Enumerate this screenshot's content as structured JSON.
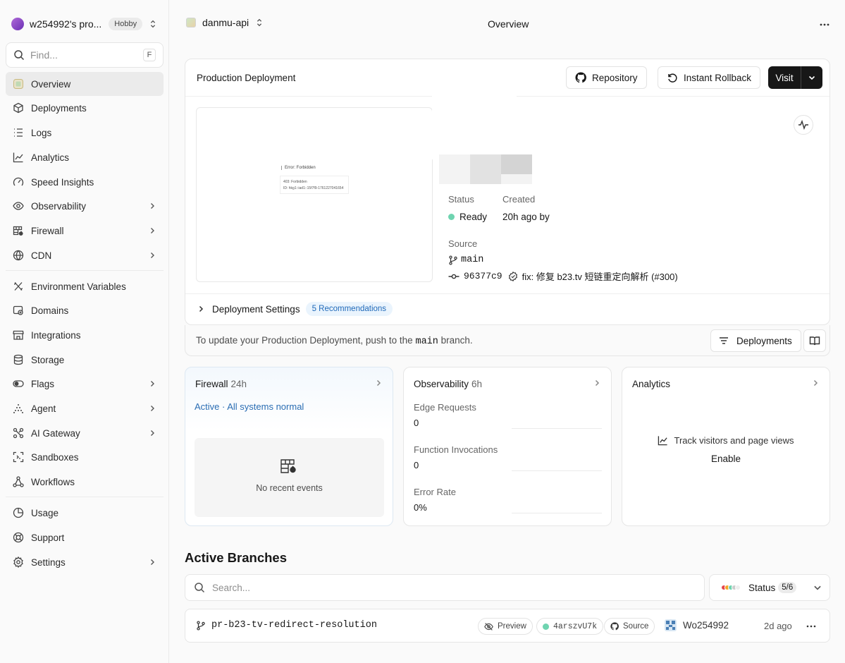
{
  "sidebar": {
    "team_name": "w254992's pro...",
    "plan_badge": "Hobby",
    "find_placeholder": "Find...",
    "find_shortcut": "F",
    "items": [
      {
        "label": "Overview",
        "icon": "overview-icon",
        "active": true
      },
      {
        "label": "Deployments",
        "icon": "cube-icon"
      },
      {
        "label": "Logs",
        "icon": "list-icon"
      },
      {
        "label": "Analytics",
        "icon": "line-chart-icon"
      },
      {
        "label": "Speed Insights",
        "icon": "gauge-icon"
      },
      {
        "label": "Observability",
        "icon": "eye-icon",
        "chevron": true
      },
      {
        "label": "Firewall",
        "icon": "firewall-icon",
        "chevron": true
      },
      {
        "label": "CDN",
        "icon": "globe-icon",
        "chevron": true
      },
      {
        "label": "Environment Variables",
        "icon": "variable-icon"
      },
      {
        "label": "Domains",
        "icon": "domain-icon"
      },
      {
        "label": "Integrations",
        "icon": "store-icon"
      },
      {
        "label": "Storage",
        "icon": "database-icon"
      },
      {
        "label": "Flags",
        "icon": "toggle-icon",
        "chevron": true
      },
      {
        "label": "Agent",
        "icon": "sparkle-icon",
        "chevron": true
      },
      {
        "label": "AI Gateway",
        "icon": "gateway-icon",
        "chevron": true
      },
      {
        "label": "Sandboxes",
        "icon": "sandbox-icon"
      },
      {
        "label": "Workflows",
        "icon": "workflow-icon"
      },
      {
        "label": "Usage",
        "icon": "pie-icon"
      },
      {
        "label": "Support",
        "icon": "lifebuoy-icon"
      },
      {
        "label": "Settings",
        "icon": "gear-icon",
        "chevron": true
      }
    ]
  },
  "topbar": {
    "project": "danmu-api",
    "title": "Overview"
  },
  "production": {
    "title": "Production Deployment",
    "repository_label": "Repository",
    "rollback_label": "Instant Rollback",
    "visit_label": "Visit",
    "preview_error_title": "Error: Forbidden",
    "preview_error_body": "403: Forbidden",
    "preview_error_code": "ID: hkg1::iad1::15f7f9-1761227041654",
    "status_label": "Status",
    "status_value": "Ready",
    "created_label": "Created",
    "created_value": "20h ago by",
    "source_label": "Source",
    "branch": "main",
    "commit_hash": "96377c9",
    "commit_message": "fix: 修复 b23.tv 短链重定向解析 (#300)",
    "settings_label": "Deployment Settings",
    "recommendations": "5 Recommendations",
    "colors": {
      "ready": "#6fd4b0",
      "accent": "#1f69b9"
    }
  },
  "update": {
    "text_prefix": "To update your Production Deployment, push to the",
    "branch": "main",
    "text_suffix": "branch.",
    "deployments_label": "Deployments"
  },
  "firewall": {
    "title": "Firewall",
    "period": "24h",
    "status": "Active · All systems normal",
    "empty": "No recent events"
  },
  "observability": {
    "title": "Observability",
    "period": "6h",
    "metrics": [
      {
        "label": "Edge Requests",
        "value": "0"
      },
      {
        "label": "Function Invocations",
        "value": "0"
      },
      {
        "label": "Error Rate",
        "value": "0%"
      }
    ]
  },
  "analytics": {
    "title": "Analytics",
    "track": "Track visitors and page views",
    "enable": "Enable"
  },
  "branches": {
    "title": "Active Branches",
    "search_placeholder": "Search...",
    "status_label": "Status",
    "status_count": "5/6",
    "status_dot_colors": [
      "#e5484d",
      "#f5a623",
      "#6fd4b0",
      "#cccccc",
      "#eeeeee"
    ],
    "rows": [
      {
        "name": "pr-b23-tv-redirect-resolution",
        "preview_label": "Preview",
        "deployment_id": "4arszvU7k",
        "source_label": "Source",
        "author": "Wo254992",
        "age": "2d ago"
      }
    ]
  }
}
